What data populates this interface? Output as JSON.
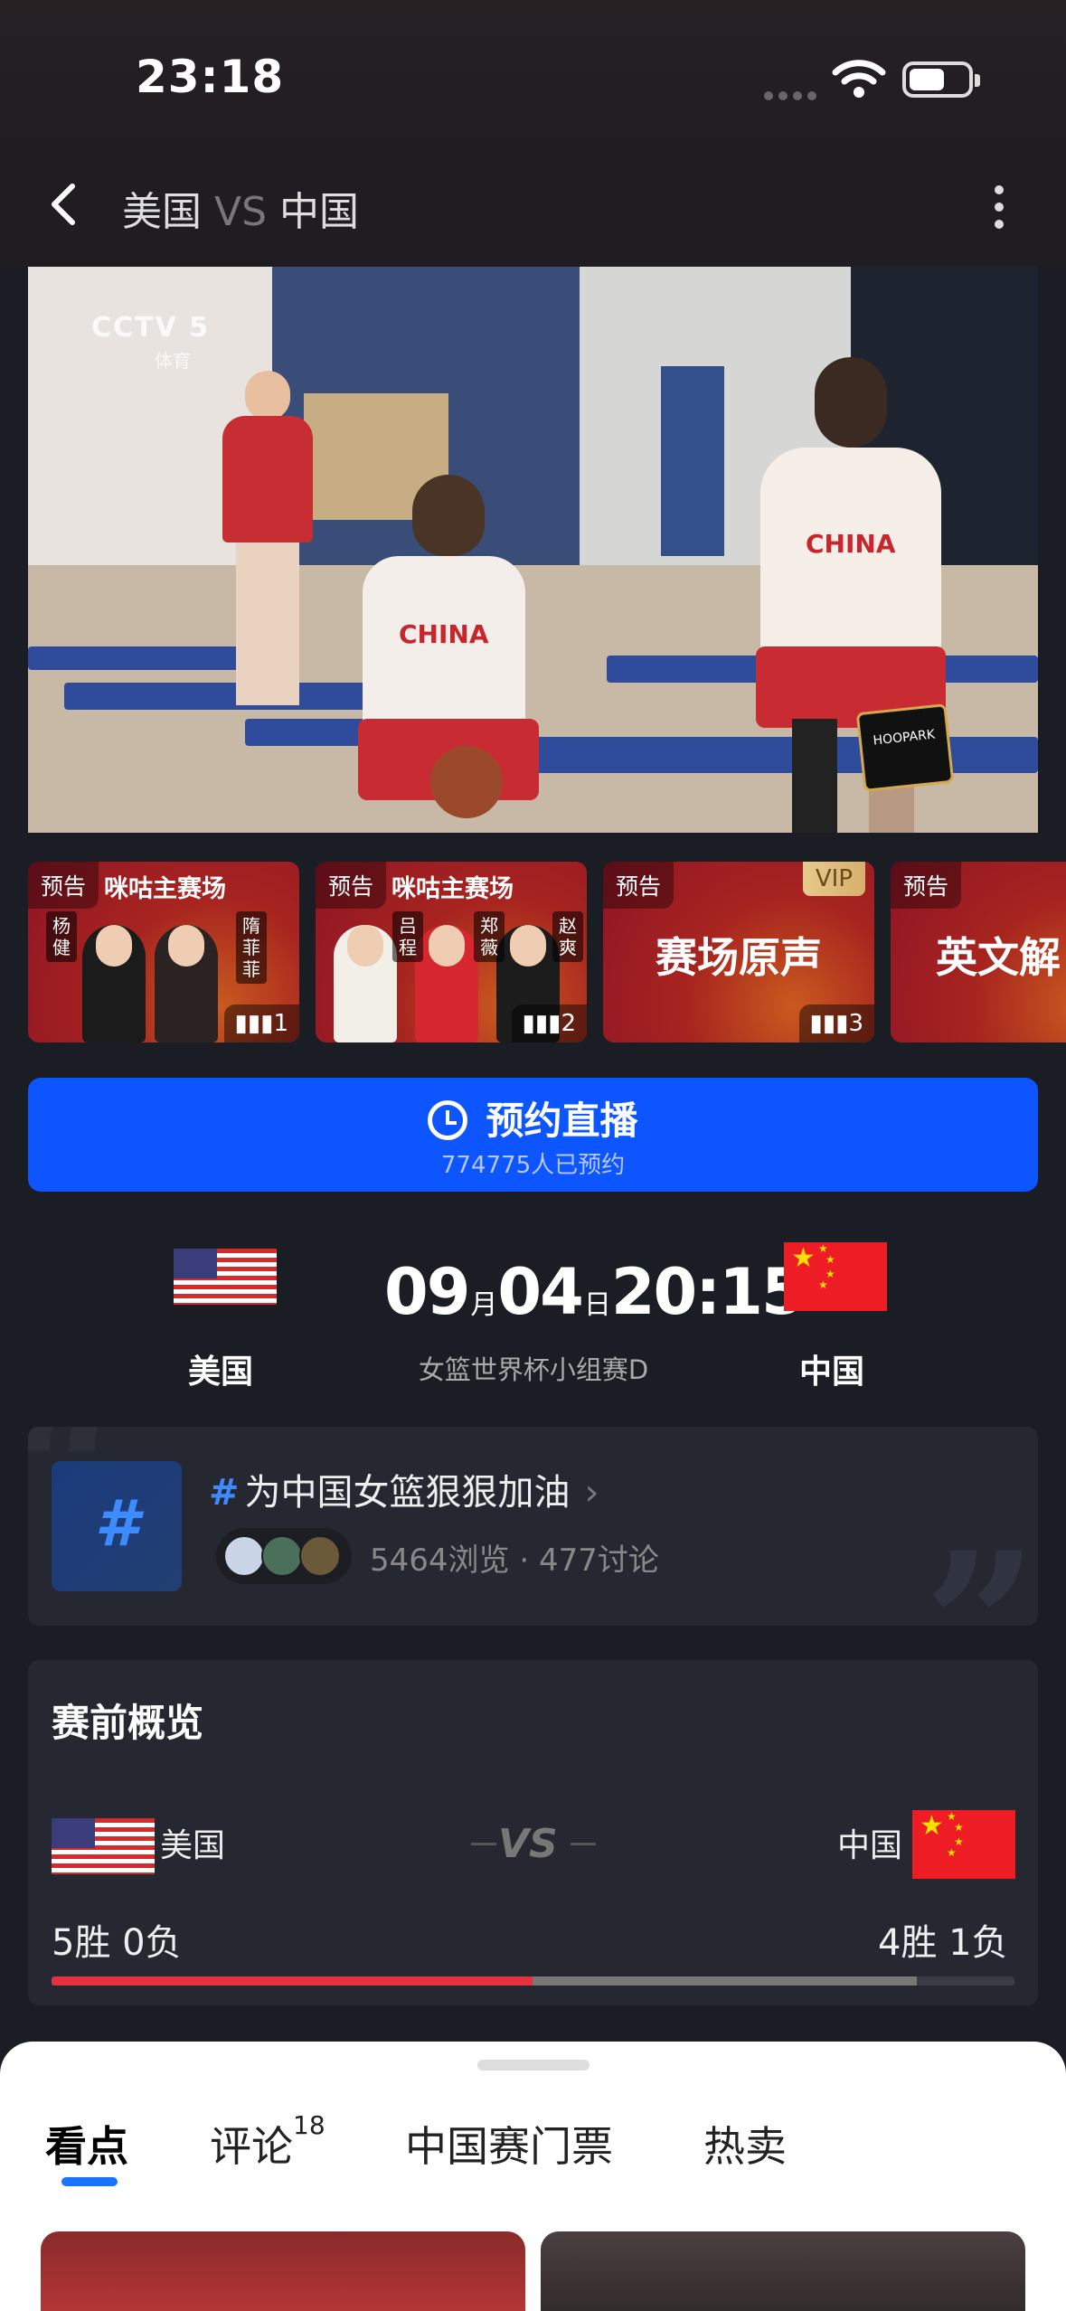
{
  "status_bar": {
    "time": "23:18"
  },
  "nav": {
    "home": "美国",
    "vs": "VS",
    "away": "中国"
  },
  "video": {
    "channel": "CCTV 5",
    "channel_sub": "体育",
    "jersey_text": "CHINA",
    "watermark": "HOOPARK"
  },
  "cards": [
    {
      "tag": "预告",
      "host": "咪咕主赛场",
      "names": [
        "杨健",
        "隋菲菲"
      ],
      "rank": "1"
    },
    {
      "tag": "预告",
      "host": "咪咕主赛场",
      "names": [
        "吕程",
        "郑薇",
        "赵爽"
      ],
      "rank": "2"
    },
    {
      "tag": "预告",
      "title": "赛场原声",
      "vip": "VIP",
      "rank": "3"
    },
    {
      "tag": "预告",
      "title": "英文解"
    }
  ],
  "reserve": {
    "label": "预约直播",
    "count": "774775人已预约"
  },
  "match": {
    "home": "美国",
    "away": "中国",
    "month": "09",
    "month_unit": "月",
    "day": "04",
    "day_unit": "日",
    "time": "20:15",
    "league": "女篮世界杯小组赛D"
  },
  "topic": {
    "icon": "#",
    "hash": "#",
    "title": "为中国女篮狠狠加油",
    "views": "5464浏览",
    "sep": "·",
    "comments": "477讨论"
  },
  "preview": {
    "title": "赛前概览",
    "home": "美国",
    "away": "中国",
    "vs": "VS",
    "home_record": "5胜 0负",
    "away_record": "4胜 1负"
  },
  "tabs": [
    {
      "label": "看点",
      "active": true
    },
    {
      "label": "评论",
      "badge": "18"
    },
    {
      "label": "中国赛门票"
    },
    {
      "label": "热卖"
    }
  ],
  "colors": {
    "accent": "#0d55ff",
    "tab_underline": "#1a73ff",
    "bar_red": "#e6303f",
    "topic_blue": "#3d8bff"
  }
}
